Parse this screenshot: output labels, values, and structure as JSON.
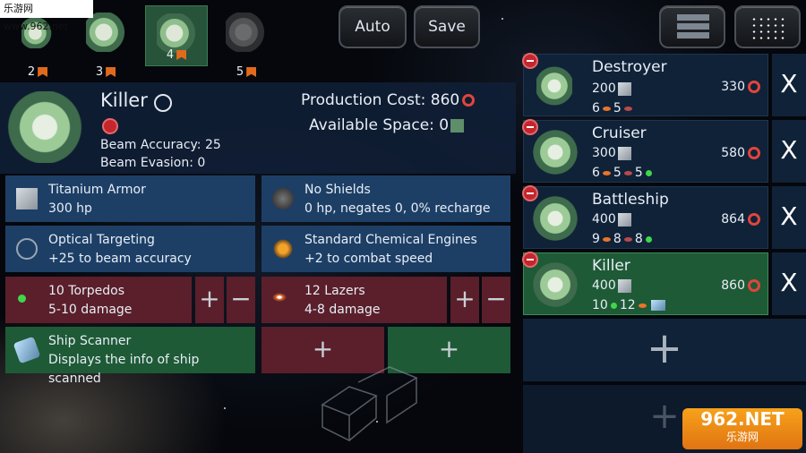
{
  "watermark": "乐游网 www.962.net",
  "top_ships": [
    {
      "count": "2"
    },
    {
      "count": "3"
    },
    {
      "count": "4"
    },
    {
      "count": "5"
    }
  ],
  "buttons": {
    "auto": "Auto",
    "save": "Save"
  },
  "ship": {
    "name": "Killer",
    "beam_accuracy": "Beam Accuracy: 25",
    "beam_evasion": "Beam Evasion: 0",
    "production_cost": "Production Cost: 860",
    "available_space": "Available Space: 0"
  },
  "modules": [
    {
      "title": "Titanium Armor",
      "detail": "300 hp"
    },
    {
      "title": "No Shields",
      "detail": "0 hp, negates 0, 0% recharge"
    },
    {
      "title": "Optical Targeting",
      "detail": "+25 to beam accuracy"
    },
    {
      "title": "Standard Chemical Engines",
      "detail": "+2 to combat speed"
    },
    {
      "title": "10 Torpedos",
      "detail": "5-10 damage"
    },
    {
      "title": "12 Lazers",
      "detail": "4-8 damage"
    },
    {
      "title": "Ship Scanner",
      "detail": "Displays the info of ship scanned"
    }
  ],
  "designs": [
    {
      "name": "Destroyer",
      "armor": "200",
      "cost": "330",
      "w1": "6",
      "w2": "5",
      "w3": ""
    },
    {
      "name": "Cruiser",
      "armor": "300",
      "cost": "580",
      "w1": "6",
      "w2": "5",
      "w3": "5"
    },
    {
      "name": "Battleship",
      "armor": "400",
      "cost": "864",
      "w1": "9",
      "w2": "8",
      "w3": "8"
    },
    {
      "name": "Killer",
      "armor": "400",
      "cost": "860",
      "w1": "10",
      "w2": "12",
      "w3": ""
    }
  ],
  "symbols": {
    "plus": "+",
    "minus": "−",
    "close": "X"
  },
  "brand": "962.NET",
  "brand_sub": "乐游网"
}
